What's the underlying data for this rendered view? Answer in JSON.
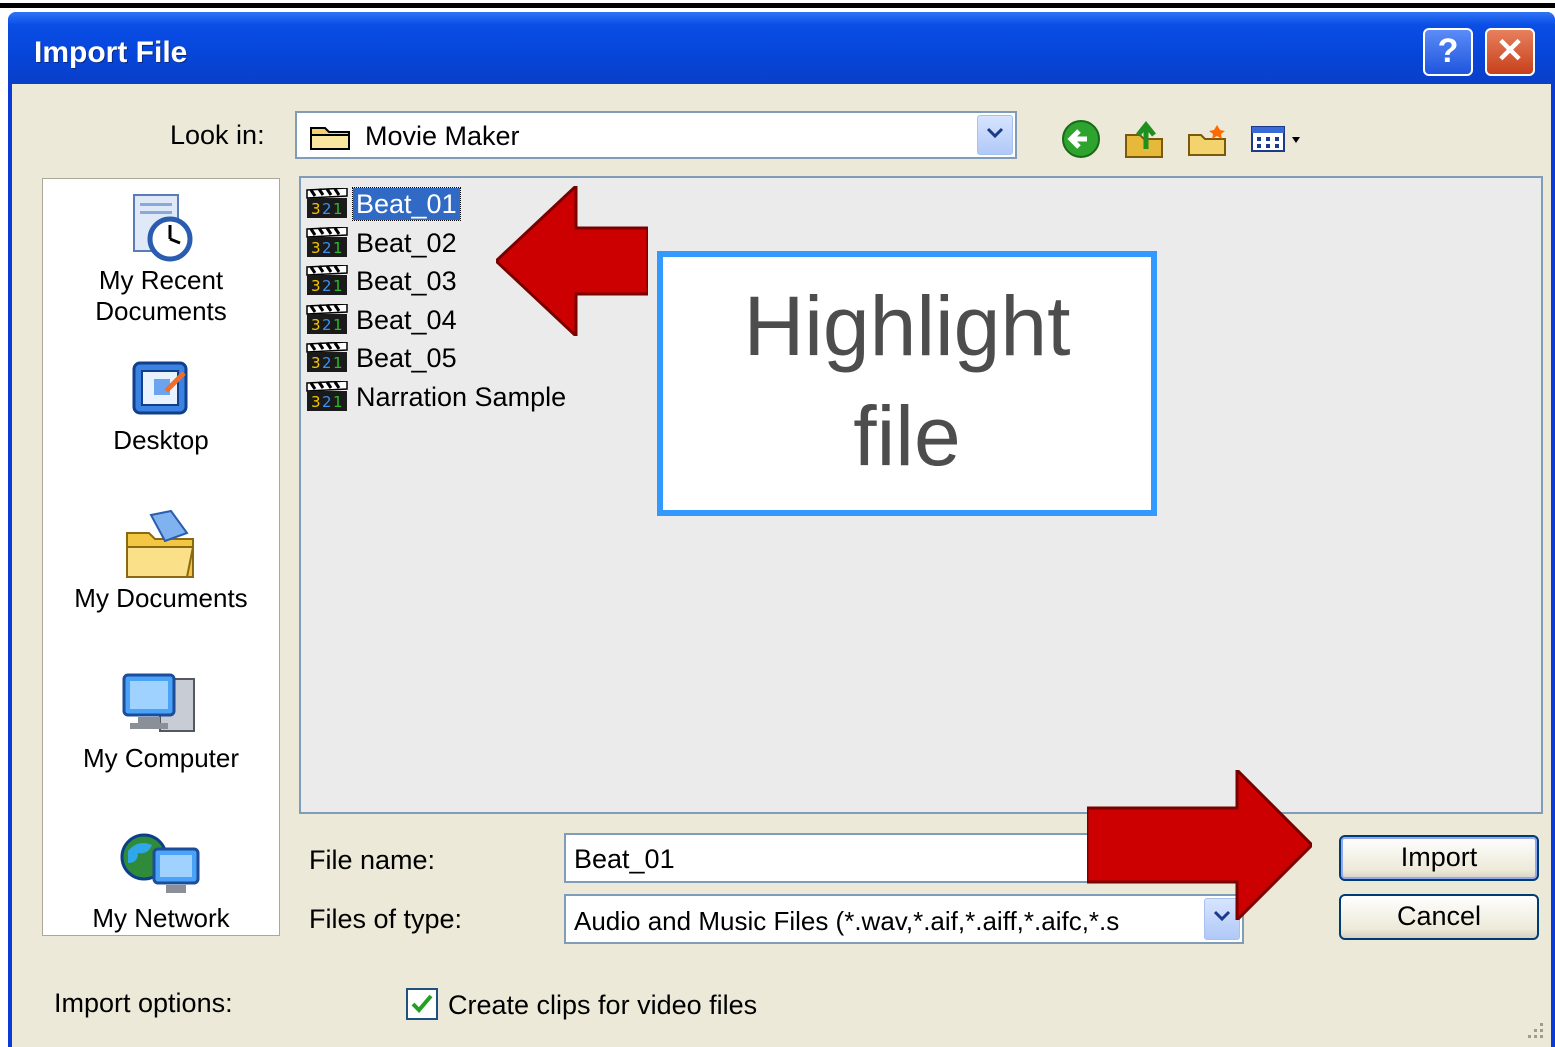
{
  "window": {
    "title": "Import File",
    "help_glyph": "?",
    "close_glyph": "✕"
  },
  "lookin": {
    "label": "Look in:",
    "value": "Movie Maker"
  },
  "places": [
    {
      "label_line1": "My Recent",
      "label_line2": "Documents",
      "icon": "recent-documents-icon"
    },
    {
      "label_line1": "Desktop",
      "label_line2": "",
      "icon": "desktop-icon"
    },
    {
      "label_line1": "My Documents",
      "label_line2": "",
      "icon": "my-documents-icon"
    },
    {
      "label_line1": "My Computer",
      "label_line2": "",
      "icon": "my-computer-icon"
    },
    {
      "label_line1": "My Network",
      "label_line2": "",
      "icon": "my-network-icon"
    }
  ],
  "files": [
    {
      "name": "Beat_01",
      "selected": true
    },
    {
      "name": "Beat_02",
      "selected": false
    },
    {
      "name": "Beat_03",
      "selected": false
    },
    {
      "name": "Beat_04",
      "selected": false
    },
    {
      "name": "Beat_05",
      "selected": false
    },
    {
      "name": "Narration Sample",
      "selected": false
    }
  ],
  "filename": {
    "label": "File name:",
    "value": "Beat_01"
  },
  "filetype": {
    "label": "Files of type:",
    "value": "Audio and Music Files (*.wav,*.aif,*.aiff,*.aifc,*.s"
  },
  "buttons": {
    "import": "Import",
    "cancel": "Cancel"
  },
  "options": {
    "label": "Import options:",
    "checkbox_label": "Create clips for video files",
    "checked": true
  },
  "callout": {
    "line1": "Highlight",
    "line2": "file"
  },
  "colors": {
    "accent": "#3399ff",
    "arrow": "#cc0000",
    "selection": "#316ac5",
    "title_bar": "#0645d9"
  }
}
